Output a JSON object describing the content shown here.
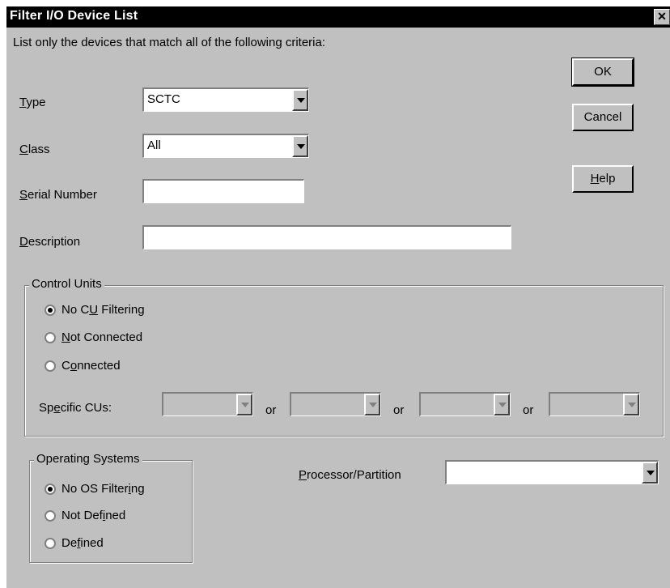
{
  "window": {
    "title": "Filter I/O Device List"
  },
  "intro": "List only the devices that match all of the following criteria:",
  "buttons": {
    "ok": "OK",
    "cancel": "Cancel",
    "help_mnemonic": "H",
    "help_rest": "elp"
  },
  "fields": {
    "type": {
      "label_mnemonic": "T",
      "label_rest": "ype",
      "value": "SCTC"
    },
    "class": {
      "label_mnemonic": "C",
      "label_rest": "lass",
      "value": "All"
    },
    "serial": {
      "label_mnemonic": "S",
      "label_rest": "erial Number",
      "value": ""
    },
    "description": {
      "label_mnemonic": "D",
      "label_rest": "escription",
      "value": ""
    }
  },
  "control_units": {
    "legend": "Control Units",
    "options": [
      {
        "pre": "No C",
        "mn": "U",
        "post": " Filtering",
        "checked": true
      },
      {
        "pre": "",
        "mn": "N",
        "post": "ot Connected",
        "checked": false
      },
      {
        "pre": "C",
        "mn": "o",
        "post": "nnected",
        "checked": false
      }
    ],
    "specific_pre": "Sp",
    "specific_mn": "e",
    "specific_post": "cific CUs:",
    "or_label": "or"
  },
  "operating_systems": {
    "legend": "Operating Systems",
    "options": [
      {
        "pre": "No OS Filter",
        "mn": "i",
        "post": "ng",
        "checked": true
      },
      {
        "pre": "Not Def",
        "mn": "i",
        "post": "ned",
        "checked": false
      },
      {
        "pre": "De",
        "mn": "f",
        "post": "ined",
        "checked": false
      }
    ]
  },
  "processor": {
    "label_mnemonic": "P",
    "label_rest": "rocessor/Partition",
    "value": ""
  }
}
